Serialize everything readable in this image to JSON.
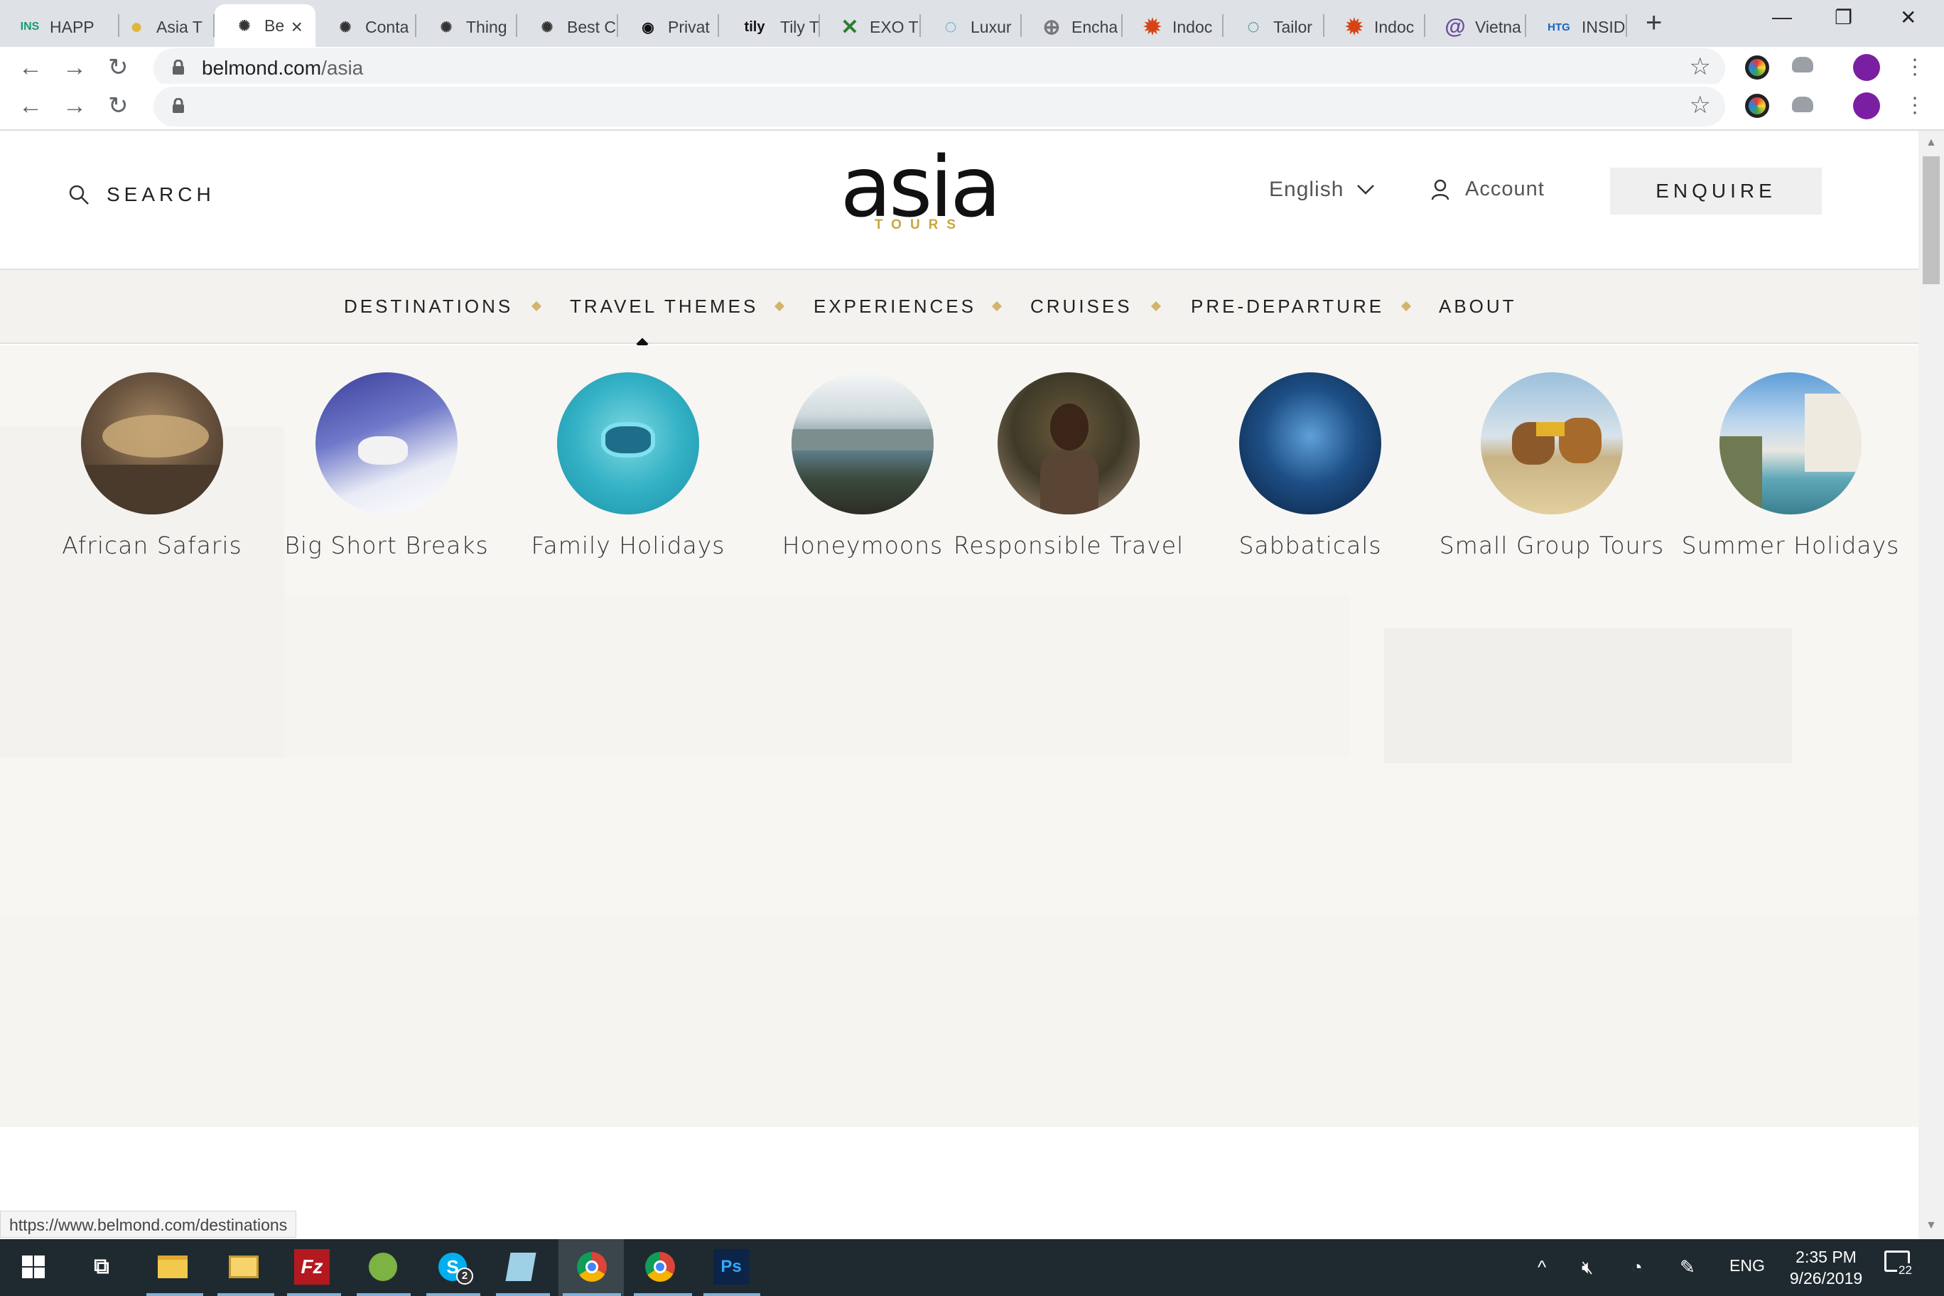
{
  "browser": {
    "tabs": [
      {
        "title": "HAPP",
        "favicon_text": "INS",
        "favicon_color": "#1a9b6a"
      },
      {
        "title": "Asia T",
        "favicon_text": "●",
        "favicon_color": "#e2b63a"
      },
      {
        "title": "Be",
        "favicon_text": "✺",
        "favicon_color": "#333333",
        "active": true
      },
      {
        "title": "Conta",
        "favicon_text": "✺",
        "favicon_color": "#333333"
      },
      {
        "title": "Thing",
        "favicon_text": "✺",
        "favicon_color": "#333333"
      },
      {
        "title": "Best C",
        "favicon_text": "✺",
        "favicon_color": "#333333"
      },
      {
        "title": "Privat",
        "favicon_text": "◉",
        "favicon_color": "#111111"
      },
      {
        "title": "Tily Tr",
        "favicon_text": "tily",
        "favicon_color": "#111111"
      },
      {
        "title": "EXO T",
        "favicon_text": "✕",
        "favicon_color": "#2e7d32"
      },
      {
        "title": "Luxur",
        "favicon_text": "◌",
        "favicon_color": "#1fa3c4"
      },
      {
        "title": "Encha",
        "favicon_text": "⊕",
        "favicon_color": "#777777"
      },
      {
        "title": "Indoc",
        "favicon_text": "✹",
        "favicon_color": "#d84315"
      },
      {
        "title": "Tailor",
        "favicon_text": "◌",
        "favicon_color": "#00796b"
      },
      {
        "title": "Indoc",
        "favicon_text": "✹",
        "favicon_color": "#d84315"
      },
      {
        "title": "Vietna",
        "favicon_text": "@",
        "favicon_color": "#6a4c9c"
      },
      {
        "title": "INSID",
        "favicon_text": "HTG",
        "favicon_color": "#1565c0"
      }
    ],
    "new_tab_label": "+",
    "window_controls": {
      "minimize": "—",
      "restore": "❐",
      "close": "✕"
    },
    "url_host": "belmond.com",
    "url_path": "/asia",
    "url2": ""
  },
  "site": {
    "search_label": "SEARCH",
    "logo_word": "asia",
    "logo_sub": "TOURS",
    "language": "English",
    "account": "Account",
    "enquire": "ENQUIRE",
    "nav": [
      "DESTINATIONS",
      "TRAVEL THEMES",
      "EXPERIENCES",
      "CRUISES",
      "PRE-DEPARTURE",
      "ABOUT"
    ],
    "active_nav": "TRAVEL THEMES",
    "themes": [
      {
        "label": "African Safaris",
        "image": "leopard-on-tree"
      },
      {
        "label": "Big Short Breaks",
        "image": "snow-mountain"
      },
      {
        "label": "Family Holidays",
        "image": "snorkel-child"
      },
      {
        "label": "Honeymoons",
        "image": "hot-tub-mountains"
      },
      {
        "label": "Responsible Travel",
        "image": "child-with-plant"
      },
      {
        "label": "Sabbaticals",
        "image": "ice-cave"
      },
      {
        "label": "Small Group Tours",
        "image": "camels-beach"
      },
      {
        "label": "Summer Holidays",
        "image": "coastal-cliff-town"
      }
    ]
  },
  "status_url": "https://www.belmond.com/destinations",
  "taskbar": {
    "language": "ENG",
    "time": "2:35 PM",
    "date": "9/26/2019",
    "notifications": "22",
    "skype_badge": "2",
    "apps": [
      "windows-start",
      "task-view",
      "file-explorer",
      "mail",
      "filezilla",
      "green-app",
      "skype",
      "notes",
      "chrome",
      "chrome",
      "photoshop"
    ]
  },
  "colors": {
    "accent_gold": "#d4b46a",
    "logo_gold": "#c9a640",
    "nav_bg": "#f3f2ef"
  }
}
